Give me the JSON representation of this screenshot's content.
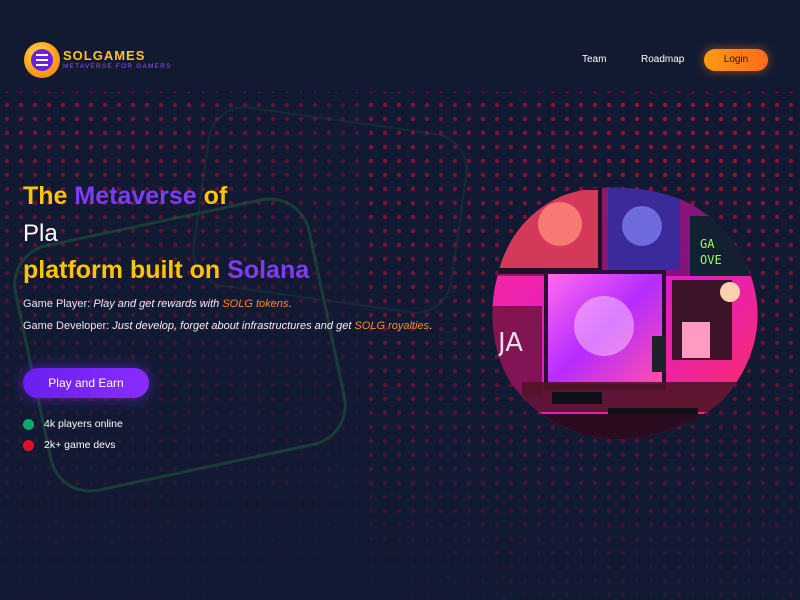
{
  "brand": {
    "name": "SOLGAMES",
    "tagline": "METAVERSE FOR GAMERS"
  },
  "nav": {
    "links": [
      "Team",
      "Roadmap"
    ],
    "login_label": "Login"
  },
  "hero": {
    "title": {
      "the": "The",
      "metaverse": "Metaverse",
      "of": "of",
      "line2": "Pla",
      "line3_a": "platform built on",
      "line3_b": "Solana"
    },
    "player_label": "Game Player:",
    "player_text": "Play and get rewards with",
    "player_token": "SOLG tokens",
    "player_end": ".",
    "dev_label": "Game Developer:",
    "dev_text": "Just develop, forget about infrastructures and get",
    "dev_token": "SOLG royalties",
    "dev_end": ".",
    "cta_label": "Play and Earn"
  },
  "stats": [
    {
      "text": "4k players online",
      "color": "#0fa86b"
    },
    {
      "text": "2k+ game devs",
      "color": "#e0102a"
    }
  ],
  "colors": {
    "accent_purple": "#7d3cf2",
    "accent_yellow": "#ffc400",
    "accent_orange": "#ff8a1e",
    "background": "#121a33"
  }
}
